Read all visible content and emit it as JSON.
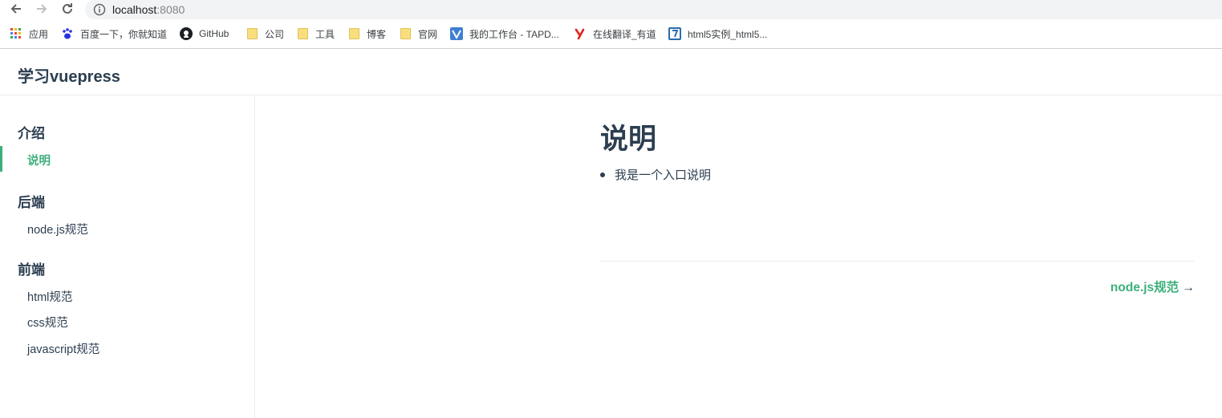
{
  "browser": {
    "url_host": "localhost",
    "url_port": ":8080",
    "bookmarks": [
      {
        "label": "应用",
        "icon": "apps-grid-icon"
      },
      {
        "label": "百度一下，你就知道",
        "icon": "baidu-paw-icon"
      },
      {
        "label": "GitHub",
        "icon": "github-icon"
      },
      {
        "label": "公司",
        "icon": "folder-icon"
      },
      {
        "label": "工具",
        "icon": "folder-icon"
      },
      {
        "label": "博客",
        "icon": "folder-icon"
      },
      {
        "label": "官网",
        "icon": "folder-icon"
      },
      {
        "label": "我的工作台 - TAPD...",
        "icon": "tapd-icon"
      },
      {
        "label": "在线翻译_有道",
        "icon": "youdao-icon"
      },
      {
        "label": "html5实例_html5...",
        "icon": "html5-site-icon"
      }
    ]
  },
  "navbar": {
    "site_name": "学习vuepress"
  },
  "sidebar": {
    "groups": [
      {
        "title": "介绍",
        "items": [
          {
            "label": "说明",
            "active": true
          }
        ]
      },
      {
        "title": "后端",
        "items": [
          {
            "label": "node.js规范"
          }
        ]
      },
      {
        "title": "前端",
        "items": [
          {
            "label": "html规范"
          },
          {
            "label": "css规范"
          },
          {
            "label": "javascript规范"
          }
        ]
      }
    ]
  },
  "main": {
    "title": "说明",
    "bullets": [
      "我是一个入口说明"
    ],
    "next_label": "node.js规范",
    "next_arrow": "→"
  },
  "colors": {
    "accent": "#3eaf7c",
    "text": "#2c3e50",
    "border": "#eaecef"
  }
}
